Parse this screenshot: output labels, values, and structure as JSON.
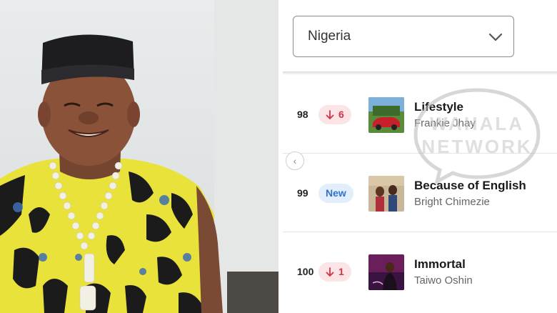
{
  "country_select": {
    "value": "Nigeria"
  },
  "chart_rows": [
    {
      "rank": "98",
      "change": "6",
      "status": "down",
      "title": "Lifestyle",
      "artist": "Frankie Jhay"
    },
    {
      "rank": "99",
      "change": "New",
      "status": "new",
      "title": "Because of English",
      "artist": "Bright Chimezie"
    },
    {
      "rank": "100",
      "change": "1",
      "status": "down",
      "title": "Immortal",
      "artist": "Taiwo Oshin"
    }
  ],
  "watermark": {
    "line1": "WAHALA",
    "line2": "NETWORK"
  },
  "icons": {
    "select_chevron": "chevron-down-icon",
    "down_arrow": "arrow-down-icon",
    "prev": "chevron-left-icon"
  },
  "colors": {
    "down_badge_bg": "#fbe4e6",
    "down_badge_text": "#d23347",
    "new_badge_bg": "#e3eefc",
    "new_badge_text": "#2f73cf"
  }
}
